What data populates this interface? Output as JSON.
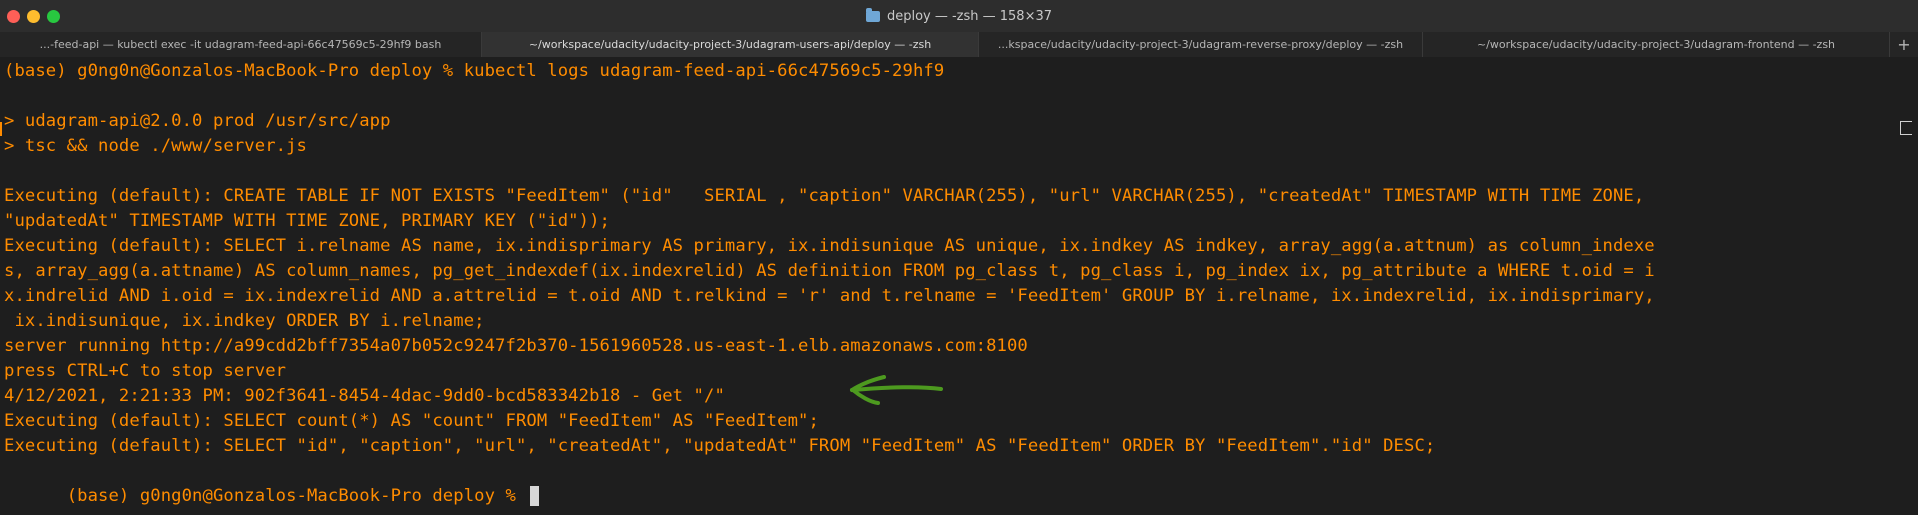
{
  "window": {
    "title": "deploy — -zsh — 158×37"
  },
  "tabs": [
    {
      "label": "...-feed-api — kubectl exec -it udagram-feed-api-66c47569c5-29hf9 bash",
      "active": false
    },
    {
      "label": "~/workspace/udacity/udacity-project-3/udagram-users-api/deploy — -zsh",
      "active": true
    },
    {
      "label": "...kspace/udacity/udacity-project-3/udagram-reverse-proxy/deploy — -zsh",
      "active": false
    },
    {
      "label": "~/workspace/udacity/udacity-project-3/udagram-frontend — -zsh",
      "active": false
    }
  ],
  "new_tab_label": "+",
  "terminal": {
    "lines": [
      "(base) g0ng0n@Gonzalos-MacBook-Pro deploy % kubectl logs udagram-feed-api-66c47569c5-29hf9",
      "",
      "> udagram-api@2.0.0 prod /usr/src/app",
      "> tsc && node ./www/server.js",
      "",
      "Executing (default): CREATE TABLE IF NOT EXISTS \"FeedItem\" (\"id\"   SERIAL , \"caption\" VARCHAR(255), \"url\" VARCHAR(255), \"createdAt\" TIMESTAMP WITH TIME ZONE,",
      "\"updatedAt\" TIMESTAMP WITH TIME ZONE, PRIMARY KEY (\"id\"));",
      "Executing (default): SELECT i.relname AS name, ix.indisprimary AS primary, ix.indisunique AS unique, ix.indkey AS indkey, array_agg(a.attnum) as column_indexe",
      "s, array_agg(a.attname) AS column_names, pg_get_indexdef(ix.indexrelid) AS definition FROM pg_class t, pg_class i, pg_index ix, pg_attribute a WHERE t.oid = i",
      "x.indrelid AND i.oid = ix.indexrelid AND a.attrelid = t.oid AND t.relkind = 'r' and t.relname = 'FeedItem' GROUP BY i.relname, ix.indexrelid, ix.indisprimary,",
      " ix.indisunique, ix.indkey ORDER BY i.relname;",
      "server running http://a99cdd2bff7354a07b052c9247f2b370-1561960528.us-east-1.elb.amazonaws.com:8100",
      "press CTRL+C to stop server",
      "4/12/2021, 2:21:33 PM: 902f3641-8454-4dac-9dd0-bcd583342b18 - Get \"/\"",
      "Executing (default): SELECT count(*) AS \"count\" FROM \"FeedItem\" AS \"FeedItem\";",
      "Executing (default): SELECT \"id\", \"caption\", \"url\", \"createdAt\", \"updatedAt\" FROM \"FeedItem\" AS \"FeedItem\" ORDER BY \"FeedItem\".\"id\" DESC;",
      "(base) g0ng0n@Gonzalos-MacBook-Pro deploy % "
    ]
  },
  "colors": {
    "terminal_text": "#ff8c00",
    "annotation": "#4d9a1f"
  },
  "icons": {
    "close": "close-icon",
    "minimize": "minimize-icon",
    "maximize": "maximize-icon",
    "folder": "folder-icon",
    "arrow": "annotation-arrow-icon"
  }
}
